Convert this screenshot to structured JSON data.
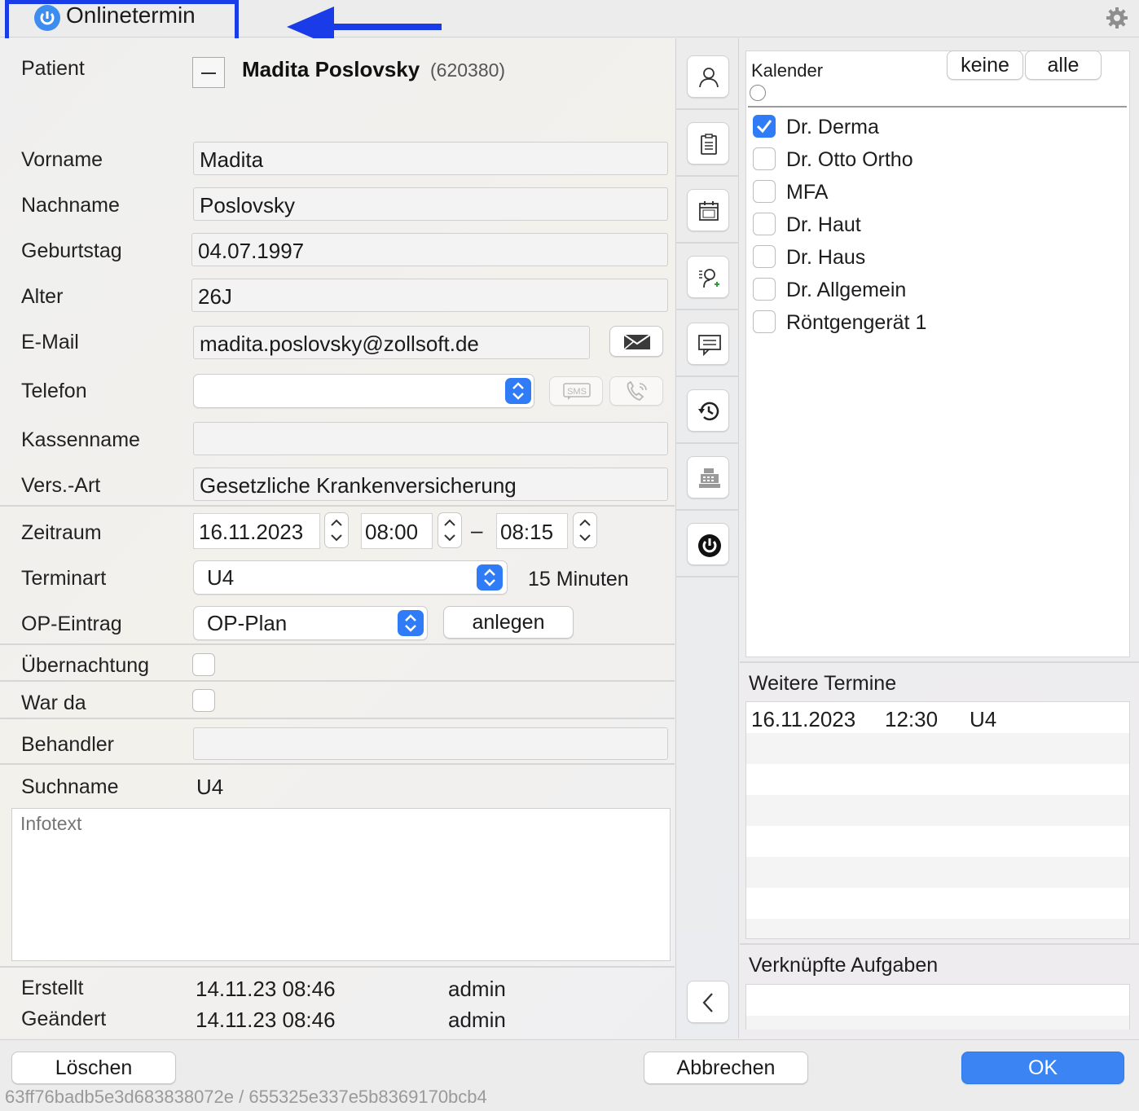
{
  "window": {
    "title": "Onlinetermin"
  },
  "patient": {
    "label": "Patient",
    "name": "Madita Poslovsky",
    "id": "(620380)"
  },
  "form": {
    "vorname": {
      "label": "Vorname",
      "value": "Madita"
    },
    "nachname": {
      "label": "Nachname",
      "value": "Poslovsky"
    },
    "geburtstag": {
      "label": "Geburtstag",
      "value": "04.07.1997"
    },
    "alter": {
      "label": "Alter",
      "value": "26J"
    },
    "email": {
      "label": "E-Mail",
      "value": "madita.poslovsky@zollsoft.de"
    },
    "telefon": {
      "label": "Telefon",
      "value": ""
    },
    "kassenname": {
      "label": "Kassenname",
      "value": ""
    },
    "versart": {
      "label": "Vers.-Art",
      "value": "Gesetzliche Krankenversicherung"
    }
  },
  "zeitraum": {
    "label": "Zeitraum",
    "date": "16.11.2023",
    "start": "08:00",
    "dash": "–",
    "end": "08:15"
  },
  "terminart": {
    "label": "Terminart",
    "value": "U4",
    "duration": "15 Minuten"
  },
  "op": {
    "label": "OP-Eintrag",
    "value": "OP-Plan",
    "button": "anlegen"
  },
  "uebernachtung": {
    "label": "Übernachtung"
  },
  "warda": {
    "label": "War da"
  },
  "behandler": {
    "label": "Behandler",
    "value": ""
  },
  "suchname": {
    "label": "Suchname",
    "value": "U4"
  },
  "infotext": {
    "placeholder": "Infotext"
  },
  "meta": {
    "erstellt_label": "Erstellt",
    "erstellt_date": "14.11.23 08:46",
    "erstellt_user": "admin",
    "geaendert_label": "Geändert",
    "geaendert_date": "14.11.23 08:46",
    "geaendert_user": "admin"
  },
  "kalender": {
    "title": "Kalender",
    "keine": "keine",
    "alle": "alle",
    "items": [
      {
        "label": "Dr. Derma",
        "checked": true
      },
      {
        "label": "Dr. Otto Ortho",
        "checked": false
      },
      {
        "label": "MFA",
        "checked": false
      },
      {
        "label": "Dr. Haut",
        "checked": false
      },
      {
        "label": "Dr. Haus",
        "checked": false
      },
      {
        "label": "Dr. Allgemein",
        "checked": false
      },
      {
        "label": "Röntgengerät 1",
        "checked": false
      }
    ]
  },
  "weitere": {
    "title": "Weitere Termine",
    "rows": [
      {
        "date": "16.11.2023",
        "time": "12:30",
        "type": "U4"
      }
    ]
  },
  "aufgaben": {
    "title": "Verknüpfte Aufgaben"
  },
  "footer": {
    "loeschen": "Löschen",
    "abbrechen": "Abbrechen",
    "ok": "OK",
    "hash": "63ff76badb5e3d683838072e / 655325e337e5b8369170bcb4"
  },
  "colors": {
    "accent": "#2f7cf6",
    "annotation": "#1a3ce8"
  }
}
